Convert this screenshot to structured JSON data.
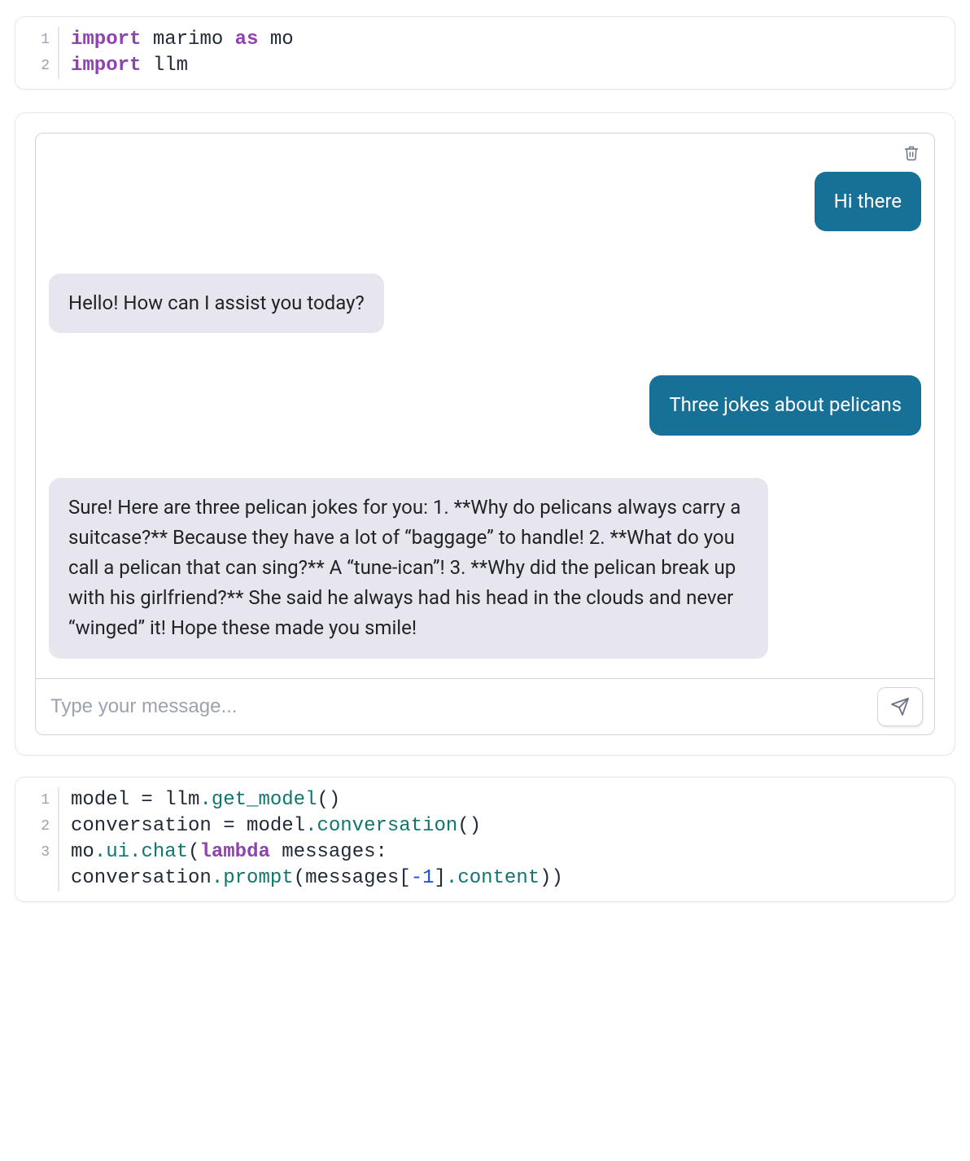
{
  "cell1": {
    "lines": [
      {
        "n": "1",
        "tokens": [
          {
            "t": "import",
            "c": "tok-kw"
          },
          {
            "t": " ",
            "c": "tok-id"
          },
          {
            "t": "marimo",
            "c": "tok-id"
          },
          {
            "t": " ",
            "c": "tok-id"
          },
          {
            "t": "as",
            "c": "tok-kw"
          },
          {
            "t": " ",
            "c": "tok-id"
          },
          {
            "t": "mo",
            "c": "tok-id"
          }
        ]
      },
      {
        "n": "2",
        "tokens": [
          {
            "t": "import",
            "c": "tok-kw"
          },
          {
            "t": " ",
            "c": "tok-id"
          },
          {
            "t": "llm",
            "c": "tok-id"
          }
        ]
      }
    ]
  },
  "chat": {
    "trash_icon": "trash-icon",
    "messages": [
      {
        "role": "user",
        "text": "Hi there"
      },
      {
        "role": "assistant",
        "text": "Hello! How can I assist you today?"
      },
      {
        "role": "user",
        "text": "Three jokes about pelicans"
      },
      {
        "role": "assistant",
        "text": "Sure! Here are three pelican jokes for you: 1. **Why do pelicans always carry a suitcase?** Because they have a lot of “baggage” to handle! 2. **What do you call a pelican that can sing?** A “tune-ican”! 3. **Why did the pelican break up with his girlfriend?** She said he always had his head in the clouds and never “winged” it! Hope these made you smile!"
      }
    ],
    "input_placeholder": "Type your message...",
    "send_icon": "send-icon"
  },
  "cell2": {
    "lines": [
      {
        "n": "1",
        "tokens": [
          {
            "t": "model",
            "c": "tok-id"
          },
          {
            "t": " ",
            "c": "tok-id"
          },
          {
            "t": "=",
            "c": "tok-op"
          },
          {
            "t": " ",
            "c": "tok-id"
          },
          {
            "t": "llm",
            "c": "tok-id"
          },
          {
            "t": ".",
            "c": "tok-dot"
          },
          {
            "t": "get_model",
            "c": "tok-fn"
          },
          {
            "t": "()",
            "c": "tok-punct"
          }
        ]
      },
      {
        "n": "2",
        "tokens": [
          {
            "t": "conversation",
            "c": "tok-id"
          },
          {
            "t": " ",
            "c": "tok-id"
          },
          {
            "t": "=",
            "c": "tok-op"
          },
          {
            "t": " ",
            "c": "tok-id"
          },
          {
            "t": "model",
            "c": "tok-id"
          },
          {
            "t": ".",
            "c": "tok-dot"
          },
          {
            "t": "conversation",
            "c": "tok-fn"
          },
          {
            "t": "()",
            "c": "tok-punct"
          }
        ]
      },
      {
        "n": "3",
        "tokens": [
          {
            "t": "mo",
            "c": "tok-id"
          },
          {
            "t": ".",
            "c": "tok-dot"
          },
          {
            "t": "ui",
            "c": "tok-fn"
          },
          {
            "t": ".",
            "c": "tok-dot"
          },
          {
            "t": "chat",
            "c": "tok-fn"
          },
          {
            "t": "(",
            "c": "tok-punct"
          },
          {
            "t": "lambda",
            "c": "tok-kw"
          },
          {
            "t": " ",
            "c": "tok-id"
          },
          {
            "t": "messages",
            "c": "tok-id"
          },
          {
            "t": ":",
            "c": "tok-punct"
          }
        ]
      },
      {
        "n": "",
        "tokens": [
          {
            "t": "conversation",
            "c": "tok-id"
          },
          {
            "t": ".",
            "c": "tok-dot"
          },
          {
            "t": "prompt",
            "c": "tok-fn"
          },
          {
            "t": "(",
            "c": "tok-punct"
          },
          {
            "t": "messages",
            "c": "tok-id"
          },
          {
            "t": "[",
            "c": "tok-punct"
          },
          {
            "t": "-1",
            "c": "tok-num"
          },
          {
            "t": "]",
            "c": "tok-punct"
          },
          {
            "t": ".",
            "c": "tok-dot"
          },
          {
            "t": "content",
            "c": "tok-fn"
          },
          {
            "t": "))",
            "c": "tok-punct"
          }
        ]
      }
    ]
  }
}
